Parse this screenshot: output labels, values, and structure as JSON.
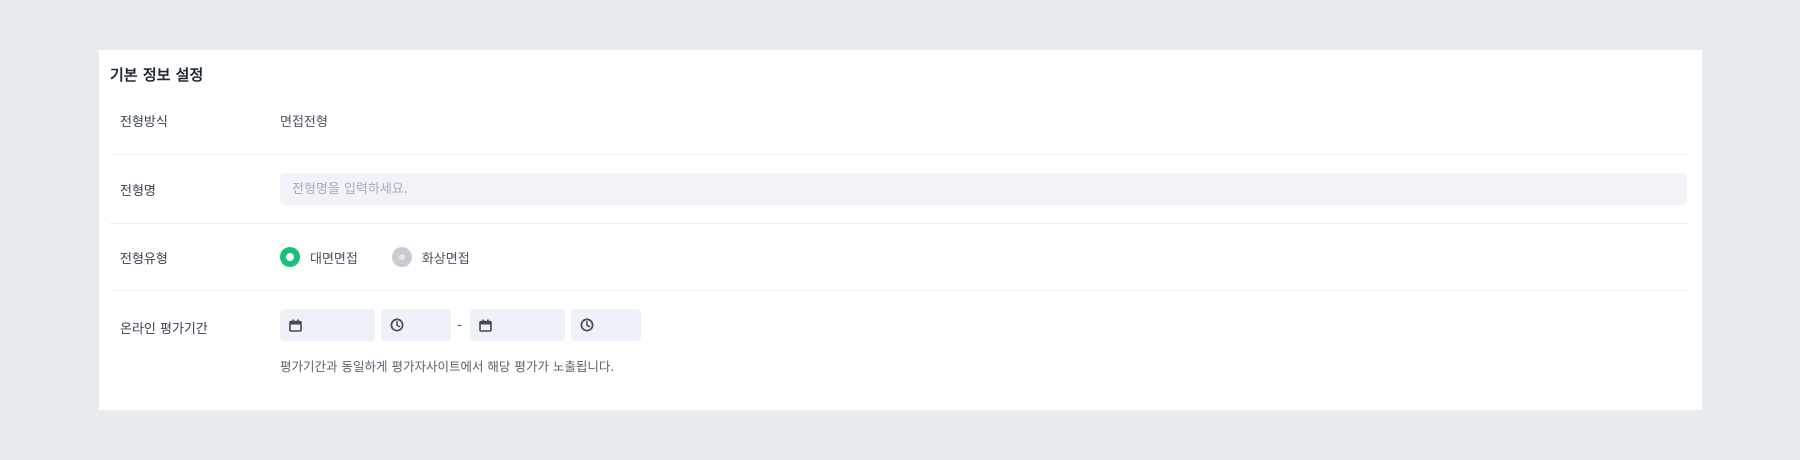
{
  "section": {
    "title": "기본 정보 설정"
  },
  "fields": {
    "method": {
      "label": "전형방식",
      "value": "면접전형"
    },
    "name": {
      "label": "전형명",
      "placeholder": "전형명을 입력하세요."
    },
    "type": {
      "label": "전형유형",
      "options": [
        {
          "label": "대면면접",
          "selected": true
        },
        {
          "label": "화상면접",
          "selected": false
        }
      ]
    },
    "period": {
      "label": "온라인 평가기간",
      "separator": "-",
      "help": "평가기간과 동일하게 평가자사이트에서 해당 평가가 노출됩니다."
    }
  },
  "colors": {
    "accent": "#19c07a",
    "page_bg": "#e8ebee",
    "input_bg": "#f1f3f8",
    "radio_off": "#c9ccd3"
  },
  "icons": [
    "calendar-icon",
    "clock-icon",
    "calendar-icon",
    "clock-icon"
  ]
}
